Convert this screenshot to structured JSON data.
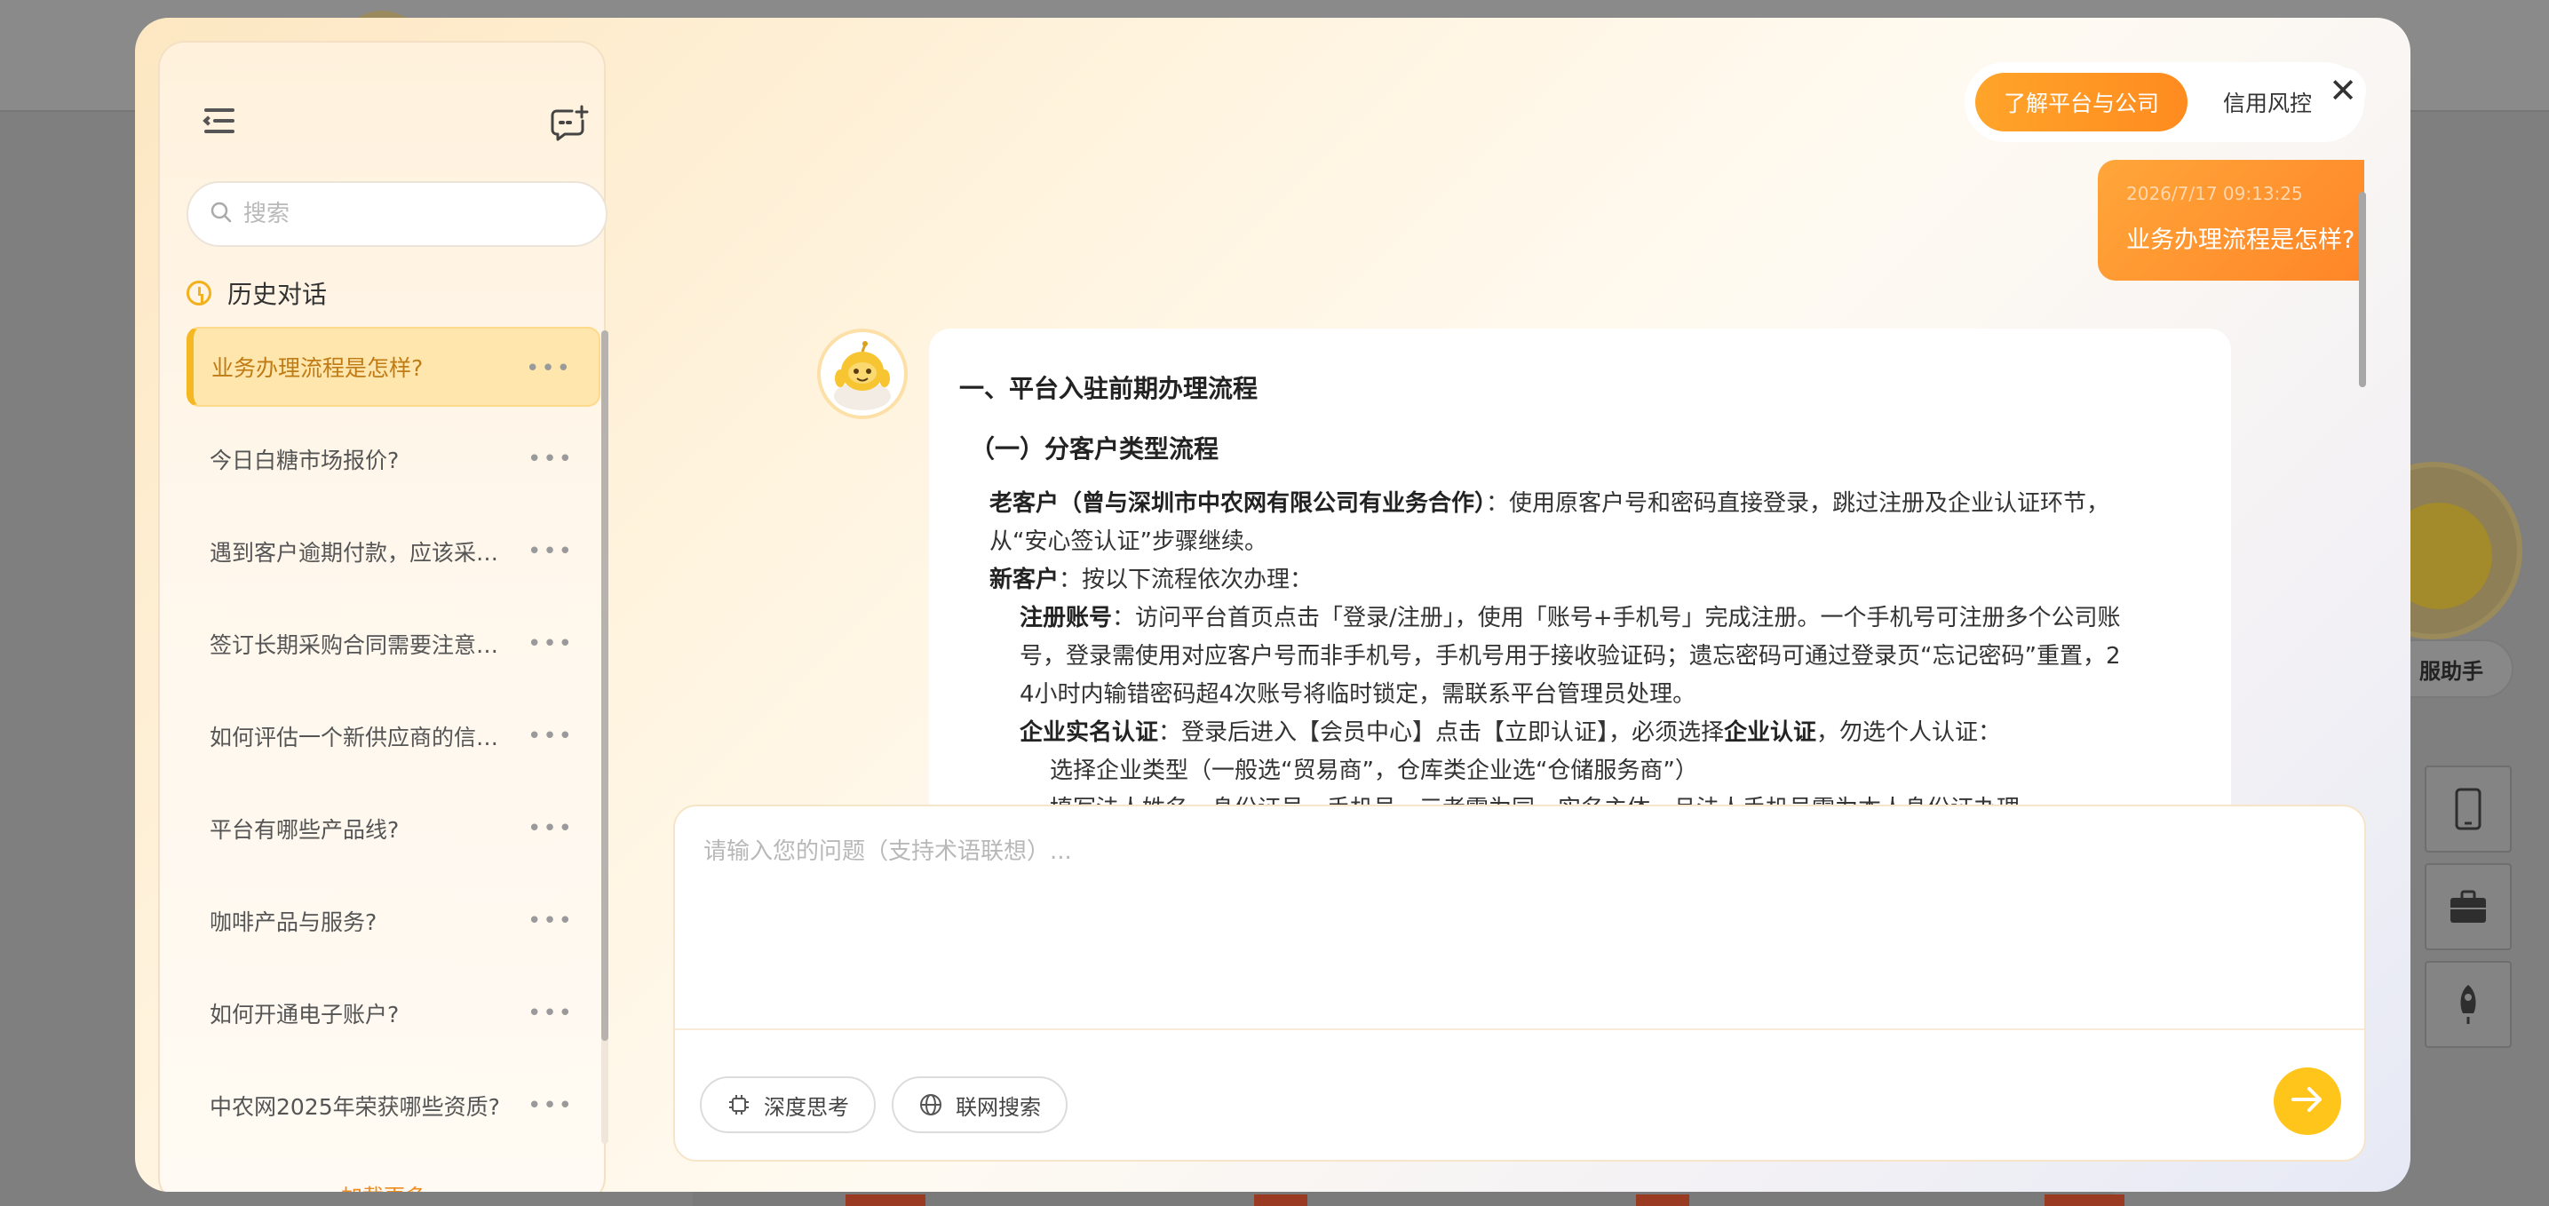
{
  "background": {
    "helper_label": "客服助手",
    "helper_visible_label": "服助手"
  },
  "modal": {
    "close_symbol": "✕"
  },
  "sidebar": {
    "search_placeholder": "搜索",
    "history_title": "历史对话",
    "items": [
      {
        "label": "业务办理流程是怎样?",
        "active": true
      },
      {
        "label": "今日白糖市场报价?",
        "active": false
      },
      {
        "label": "遇到客户逾期付款，应该采…",
        "active": false
      },
      {
        "label": "签订长期采购合同需要注意…",
        "active": false
      },
      {
        "label": "如何评估一个新供应商的信…",
        "active": false
      },
      {
        "label": "平台有哪些产品线?",
        "active": false
      },
      {
        "label": "咖啡产品与服务?",
        "active": false
      },
      {
        "label": "如何开通电子账户?",
        "active": false
      },
      {
        "label": "中农网2025年荣获哪些资质?",
        "active": false
      }
    ],
    "more_symbol": "•••",
    "load_more": "加载更多"
  },
  "tabs": [
    {
      "label": "了解平台与公司",
      "active": true
    },
    {
      "label": "信用风控",
      "active": false
    }
  ],
  "chat": {
    "user_message": {
      "time": "2026/7/17 09:13:25",
      "text": "业务办理流程是怎样?"
    },
    "bot_message": {
      "heading1": "一、平台入驻前期办理流程",
      "heading2": "（一）分客户类型流程",
      "old_customer_label": "老客户（曾与深圳市中农网有限公司有业务合作）",
      "old_customer_text": "：使用原客户号和密码直接登录，跳过注册及企业认证环节，",
      "old_customer_text2": "从“安心签认证”步骤继续。",
      "new_customer_label": "新客户",
      "new_customer_text": "：按以下流程依次办理：",
      "register_label": "注册账号",
      "register_text1": "：访问平台首页点击「登录/注册」，使用「账号+手机号」完成注册。一个手机号可注册多个公司账",
      "register_text2": "号，登录需使用对应客户号而非手机号，手机号用于接收验证码；遗忘密码可通过登录页“忘记密码”重置，2",
      "register_text3": "4小时内输错密码超4次账号将临时锁定，需联系平台管理员处理。",
      "auth_label": "企业实名认证",
      "auth_text_a": "：登录后进入【会员中心】点击【立即认证】，必须选择",
      "auth_bold": "企业认证",
      "auth_text_b": "，勿选个人认证：",
      "step1": "选择企业类型（一般选“贸易商”，仓库类企业选“仓储服务商”）",
      "step2": "填写法人姓名、身份证号、手机号，三者需为同一实名主体，且法人手机号需为本人身份证办理"
    }
  },
  "input": {
    "placeholder": "请输入您的问题（支持术语联想）...",
    "deep_think_label": "深度思考",
    "web_search_label": "联网搜索"
  },
  "colors": {
    "accent": "#ff8b1f",
    "send_button": "#ffc51a",
    "active_item_text": "#c07b14",
    "load_more": "#ef8a1c"
  },
  "icons": {
    "sidebar_toggle": "menu-collapse-icon",
    "new_chat": "new-chat-icon",
    "search": "search-icon",
    "history": "clock-icon",
    "close": "close-icon",
    "user_avatar": "user-icon",
    "deep_think": "chip-icon",
    "web_search": "globe-icon",
    "send": "arrow-right-icon"
  }
}
